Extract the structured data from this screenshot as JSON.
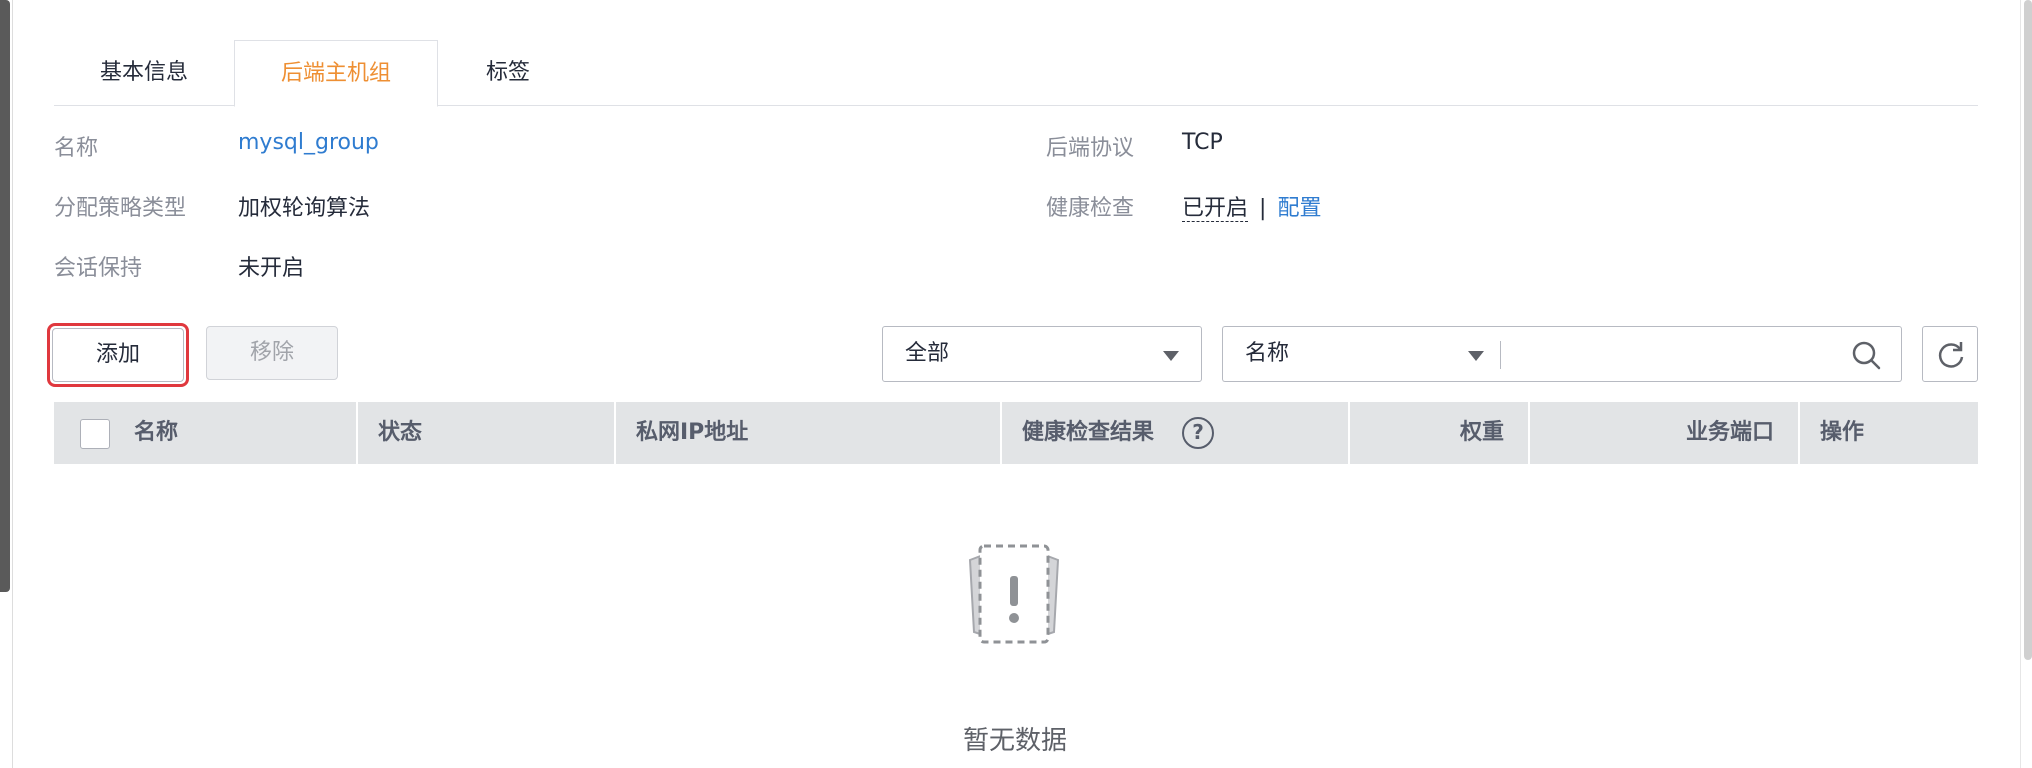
{
  "tabs": [
    {
      "label": "基本信息",
      "active": false
    },
    {
      "label": "后端主机组",
      "active": true
    },
    {
      "label": "标签",
      "active": false
    }
  ],
  "info": {
    "name_label": "名称",
    "name_value": "mysql_group",
    "policy_label": "分配策略类型",
    "policy_value": "加权轮询算法",
    "session_label": "会话保持",
    "session_value": "未开启",
    "protocol_label": "后端协议",
    "protocol_value": "TCP",
    "health_label": "健康检查",
    "health_value": "已开启",
    "health_separator": "|",
    "health_config_link": "配置"
  },
  "toolbar": {
    "add_label": "添加",
    "remove_label": "移除",
    "filter_status": "全部",
    "search_field": "名称",
    "search_placeholder": ""
  },
  "table": {
    "columns": [
      "名称",
      "状态",
      "私网IP地址",
      "健康检查结果",
      "权重",
      "业务端口",
      "操作"
    ],
    "rows": [],
    "empty_text": "暂无数据"
  },
  "colors": {
    "accent": "#ee8f33",
    "link": "#2f7cd0",
    "highlight_outline": "#e0383e",
    "header_bg": "#e2e4e6"
  },
  "icons": {
    "search": "search-icon",
    "refresh": "refresh-icon",
    "help": "question-circle-icon",
    "empty": "empty-data-icon",
    "dropdown": "caret-down-icon"
  }
}
